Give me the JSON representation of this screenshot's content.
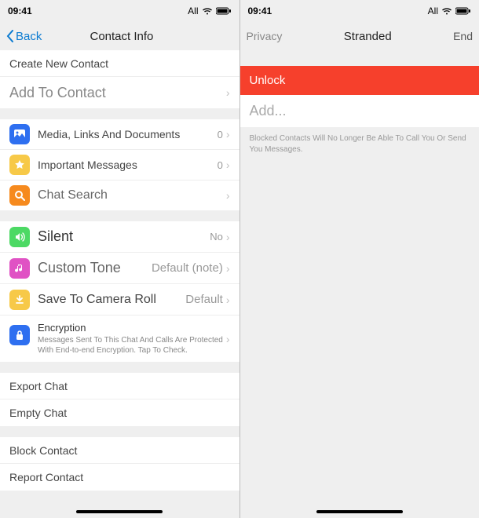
{
  "left": {
    "status": {
      "time": "09:41",
      "carrier": "All"
    },
    "nav": {
      "back": "Back",
      "title": "Contact Info"
    },
    "create": "Create New Contact",
    "addTo": "Add To Contact",
    "media": {
      "label": "Media, Links And Documents",
      "value": "0"
    },
    "important": {
      "label": "Important Messages",
      "value": "0"
    },
    "search": {
      "label": "Chat Search"
    },
    "silent": {
      "label": "Silent",
      "value": "No"
    },
    "tone": {
      "label": "Custom Tone",
      "value": "Default (note)"
    },
    "save": {
      "label": "Save To Camera Roll",
      "value": "Default"
    },
    "encryption": {
      "title": "Encryption",
      "desc": "Messages Sent To This Chat And Calls Are Protected With End-to-end Encryption. Tap To Check."
    },
    "export": "Export Chat",
    "empty": "Empty Chat",
    "block": "Block Contact",
    "report": "Report Contact"
  },
  "right": {
    "status": {
      "time": "09:41",
      "carrier": "All"
    },
    "nav": {
      "left": "Privacy",
      "title": "Stranded",
      "right": "End"
    },
    "unlock": "Unlock",
    "add": "Add...",
    "note": "Blocked Contacts Will No Longer Be Able To Call You Or Send You Messages."
  }
}
